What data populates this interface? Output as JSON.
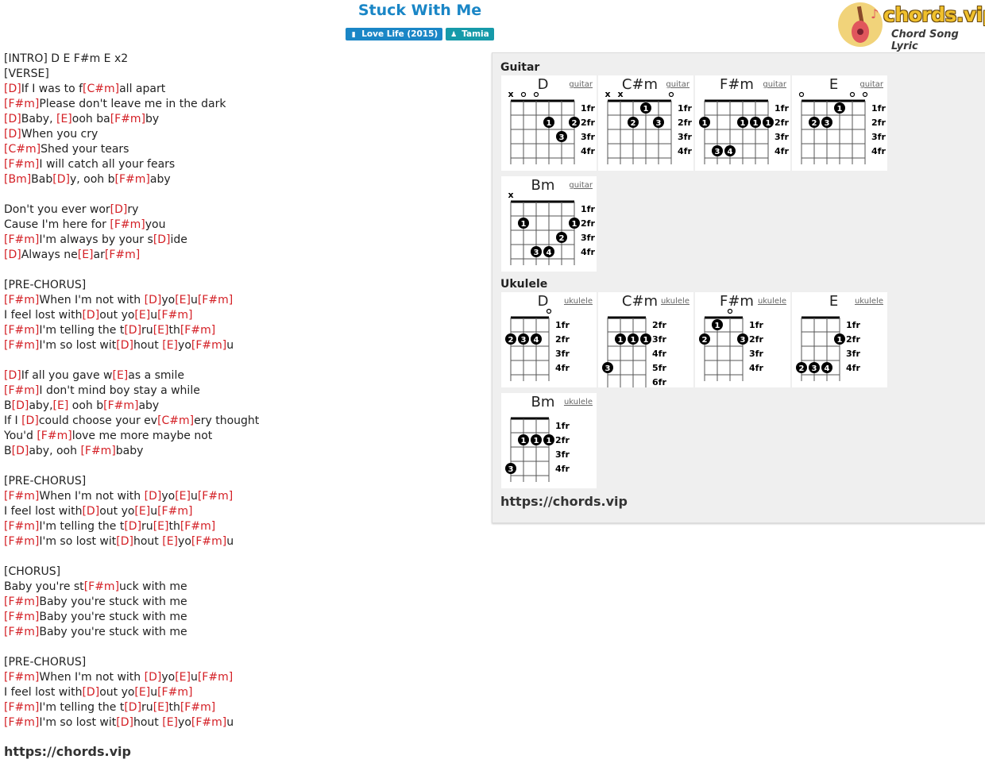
{
  "song": {
    "title": "Stuck With Me",
    "album_tag": "Love Life (2015)",
    "artist_tag": "Tamia"
  },
  "logo": {
    "brand": "chords.vip",
    "tagline": "Chord Song Lyric"
  },
  "lyrics": [
    [
      {
        "t": "[INTRO] D E F#m E x2"
      }
    ],
    [
      {
        "t": "[VERSE]"
      }
    ],
    [
      {
        "c": "[D]"
      },
      {
        "t": "If I was to f"
      },
      {
        "c": "[C#m]"
      },
      {
        "t": "all apart"
      }
    ],
    [
      {
        "c": "[F#m]"
      },
      {
        "t": "Please don't leave me in the dark"
      }
    ],
    [
      {
        "c": "[D]"
      },
      {
        "t": "Baby, "
      },
      {
        "c": "[E]"
      },
      {
        "t": "ooh ba"
      },
      {
        "c": "[F#m]"
      },
      {
        "t": "by"
      }
    ],
    [
      {
        "c": "[D]"
      },
      {
        "t": "When you cry"
      }
    ],
    [
      {
        "c": "[C#m]"
      },
      {
        "t": "Shed your tears"
      }
    ],
    [
      {
        "c": "[F#m]"
      },
      {
        "t": "I will catch all your fears"
      }
    ],
    [
      {
        "c": "[Bm]"
      },
      {
        "t": "Bab"
      },
      {
        "c": "[D]"
      },
      {
        "t": "y, ooh b"
      },
      {
        "c": "[F#m]"
      },
      {
        "t": "aby"
      }
    ],
    [],
    [
      {
        "t": "Don't you ever wor"
      },
      {
        "c": "[D]"
      },
      {
        "t": "ry"
      }
    ],
    [
      {
        "t": "Cause I'm here for "
      },
      {
        "c": "[F#m]"
      },
      {
        "t": "you"
      }
    ],
    [
      {
        "c": "[F#m]"
      },
      {
        "t": "I'm always by your s"
      },
      {
        "c": "[D]"
      },
      {
        "t": "ide"
      }
    ],
    [
      {
        "c": "[D]"
      },
      {
        "t": "Always ne"
      },
      {
        "c": "[E]"
      },
      {
        "t": "ar"
      },
      {
        "c": "[F#m]"
      }
    ],
    [],
    [
      {
        "t": "[PRE-CHORUS]"
      }
    ],
    [
      {
        "c": "[F#m]"
      },
      {
        "t": "When I'm not with "
      },
      {
        "c": "[D]"
      },
      {
        "t": "yo"
      },
      {
        "c": "[E]"
      },
      {
        "t": "u"
      },
      {
        "c": "[F#m]"
      }
    ],
    [
      {
        "t": "I feel lost with"
      },
      {
        "c": "[D]"
      },
      {
        "t": "out yo"
      },
      {
        "c": "[E]"
      },
      {
        "t": "u"
      },
      {
        "c": "[F#m]"
      }
    ],
    [
      {
        "c": "[F#m]"
      },
      {
        "t": "I'm telling the t"
      },
      {
        "c": "[D]"
      },
      {
        "t": "ru"
      },
      {
        "c": "[E]"
      },
      {
        "t": "th"
      },
      {
        "c": "[F#m]"
      }
    ],
    [
      {
        "c": "[F#m]"
      },
      {
        "t": "I'm so lost wit"
      },
      {
        "c": "[D]"
      },
      {
        "t": "hout "
      },
      {
        "c": "[E]"
      },
      {
        "t": "yo"
      },
      {
        "c": "[F#m]"
      },
      {
        "t": "u"
      }
    ],
    [],
    [
      {
        "c": "[D]"
      },
      {
        "t": "If all you gave w"
      },
      {
        "c": "[E]"
      },
      {
        "t": "as a smile"
      }
    ],
    [
      {
        "c": "[F#m]"
      },
      {
        "t": "I don't mind boy stay a while"
      }
    ],
    [
      {
        "t": "B"
      },
      {
        "c": "[D]"
      },
      {
        "t": "aby,"
      },
      {
        "c": "[E]"
      },
      {
        "t": " ooh b"
      },
      {
        "c": "[F#m]"
      },
      {
        "t": "aby"
      }
    ],
    [
      {
        "t": "If I "
      },
      {
        "c": "[D]"
      },
      {
        "t": "could choose your ev"
      },
      {
        "c": "[C#m]"
      },
      {
        "t": "ery thought"
      }
    ],
    [
      {
        "t": "You'd "
      },
      {
        "c": "[F#m]"
      },
      {
        "t": "love me more maybe not"
      }
    ],
    [
      {
        "t": "B"
      },
      {
        "c": "[D]"
      },
      {
        "t": "aby, ooh "
      },
      {
        "c": "[F#m]"
      },
      {
        "t": "baby"
      }
    ],
    [],
    [
      {
        "t": "[PRE-CHORUS]"
      }
    ],
    [
      {
        "c": "[F#m]"
      },
      {
        "t": "When I'm not with "
      },
      {
        "c": "[D]"
      },
      {
        "t": "yo"
      },
      {
        "c": "[E]"
      },
      {
        "t": "u"
      },
      {
        "c": "[F#m]"
      }
    ],
    [
      {
        "t": "I feel lost with"
      },
      {
        "c": "[D]"
      },
      {
        "t": "out yo"
      },
      {
        "c": "[E]"
      },
      {
        "t": "u"
      },
      {
        "c": "[F#m]"
      }
    ],
    [
      {
        "c": "[F#m]"
      },
      {
        "t": "I'm telling the t"
      },
      {
        "c": "[D]"
      },
      {
        "t": "ru"
      },
      {
        "c": "[E]"
      },
      {
        "t": "th"
      },
      {
        "c": "[F#m]"
      }
    ],
    [
      {
        "c": "[F#m]"
      },
      {
        "t": "I'm so lost wit"
      },
      {
        "c": "[D]"
      },
      {
        "t": "hout "
      },
      {
        "c": "[E]"
      },
      {
        "t": "yo"
      },
      {
        "c": "[F#m]"
      },
      {
        "t": "u"
      }
    ],
    [],
    [
      {
        "t": "[CHORUS]"
      }
    ],
    [
      {
        "t": "Baby you're st"
      },
      {
        "c": "[F#m]"
      },
      {
        "t": "uck with me"
      }
    ],
    [
      {
        "c": "[F#m]"
      },
      {
        "t": "Baby you're stuck with me"
      }
    ],
    [
      {
        "c": "[F#m]"
      },
      {
        "t": "Baby you're stuck with me"
      }
    ],
    [
      {
        "c": "[F#m]"
      },
      {
        "t": "Baby you're stuck with me"
      }
    ],
    [],
    [
      {
        "t": "[PRE-CHORUS]"
      }
    ],
    [
      {
        "c": "[F#m]"
      },
      {
        "t": "When I'm not with "
      },
      {
        "c": "[D]"
      },
      {
        "t": "yo"
      },
      {
        "c": "[E]"
      },
      {
        "t": "u"
      },
      {
        "c": "[F#m]"
      }
    ],
    [
      {
        "t": "I feel lost with"
      },
      {
        "c": "[D]"
      },
      {
        "t": "out yo"
      },
      {
        "c": "[E]"
      },
      {
        "t": "u"
      },
      {
        "c": "[F#m]"
      }
    ],
    [
      {
        "c": "[F#m]"
      },
      {
        "t": "I'm telling the t"
      },
      {
        "c": "[D]"
      },
      {
        "t": "ru"
      },
      {
        "c": "[E]"
      },
      {
        "t": "th"
      },
      {
        "c": "[F#m]"
      }
    ],
    [
      {
        "c": "[F#m]"
      },
      {
        "t": "I'm so lost wit"
      },
      {
        "c": "[D]"
      },
      {
        "t": "hout "
      },
      {
        "c": "[E]"
      },
      {
        "t": "yo"
      },
      {
        "c": "[F#m]"
      },
      {
        "t": "u"
      }
    ]
  ],
  "footer_url": "https://chords.vip",
  "panel": {
    "guitar_label": "Guitar",
    "ukulele_label": "Ukulele",
    "url": "https://chords.vip",
    "guitar_chords": [
      {
        "name": "D",
        "inst": "guitar",
        "frets": [
          "1fr",
          "2fr",
          "3fr",
          "4fr"
        ],
        "marks": [
          {
            "s": 0,
            "m": "x"
          },
          {
            "s": 1,
            "m": "o"
          },
          {
            "s": 2,
            "m": "o"
          }
        ],
        "dots": [
          {
            "s": 3,
            "f": 2,
            "n": "1"
          },
          {
            "s": 5,
            "f": 2,
            "n": "2"
          },
          {
            "s": 4,
            "f": 3,
            "n": "3"
          }
        ]
      },
      {
        "name": "C#m",
        "inst": "guitar",
        "frets": [
          "1fr",
          "2fr",
          "3fr",
          "4fr"
        ],
        "marks": [
          {
            "s": 0,
            "m": "x"
          },
          {
            "s": 1,
            "m": "x"
          },
          {
            "s": 5,
            "m": "o"
          }
        ],
        "dots": [
          {
            "s": 3,
            "f": 1,
            "n": "1"
          },
          {
            "s": 2,
            "f": 2,
            "n": "2"
          },
          {
            "s": 4,
            "f": 2,
            "n": "3"
          }
        ]
      },
      {
        "name": "F#m",
        "inst": "guitar",
        "frets": [
          "1fr",
          "2fr",
          "3fr",
          "4fr"
        ],
        "marks": [],
        "dots": [
          {
            "s": 0,
            "f": 2,
            "n": "1"
          },
          {
            "s": 3,
            "f": 2,
            "n": "1"
          },
          {
            "s": 4,
            "f": 2,
            "n": "1"
          },
          {
            "s": 5,
            "f": 2,
            "n": "1"
          },
          {
            "s": 1,
            "f": 4,
            "n": "3"
          },
          {
            "s": 2,
            "f": 4,
            "n": "4"
          }
        ]
      },
      {
        "name": "E",
        "inst": "guitar",
        "frets": [
          "1fr",
          "2fr",
          "3fr",
          "4fr"
        ],
        "marks": [
          {
            "s": 0,
            "m": "o"
          },
          {
            "s": 4,
            "m": "o"
          },
          {
            "s": 5,
            "m": "o"
          }
        ],
        "dots": [
          {
            "s": 3,
            "f": 1,
            "n": "1"
          },
          {
            "s": 1,
            "f": 2,
            "n": "2"
          },
          {
            "s": 2,
            "f": 2,
            "n": "3"
          }
        ]
      },
      {
        "name": "Bm",
        "inst": "guitar",
        "frets": [
          "1fr",
          "2fr",
          "3fr",
          "4fr"
        ],
        "marks": [
          {
            "s": 0,
            "m": "x"
          }
        ],
        "dots": [
          {
            "s": 1,
            "f": 2,
            "n": "1"
          },
          {
            "s": 5,
            "f": 2,
            "n": "1"
          },
          {
            "s": 4,
            "f": 3,
            "n": "2"
          },
          {
            "s": 2,
            "f": 4,
            "n": "3"
          },
          {
            "s": 3,
            "f": 4,
            "n": "4"
          }
        ]
      }
    ],
    "ukulele_chords": [
      {
        "name": "D",
        "inst": "ukulele",
        "frets": [
          "1fr",
          "2fr",
          "3fr",
          "4fr"
        ],
        "marks": [
          {
            "s": 3,
            "m": "o"
          }
        ],
        "dots": [
          {
            "s": 0,
            "f": 2,
            "n": "2"
          },
          {
            "s": 1,
            "f": 2,
            "n": "3"
          },
          {
            "s": 2,
            "f": 2,
            "n": "4"
          }
        ]
      },
      {
        "name": "C#m",
        "inst": "ukulele",
        "frets": [
          "2fr",
          "3fr",
          "4fr",
          "5fr",
          "6fr"
        ],
        "marks": [],
        "dots": [
          {
            "s": 1,
            "f": 2,
            "n": "1"
          },
          {
            "s": 2,
            "f": 2,
            "n": "1"
          },
          {
            "s": 3,
            "f": 2,
            "n": "1"
          },
          {
            "s": 0,
            "f": 4,
            "n": "3"
          }
        ]
      },
      {
        "name": "F#m",
        "inst": "ukulele",
        "frets": [
          "1fr",
          "2fr",
          "3fr",
          "4fr"
        ],
        "marks": [
          {
            "s": 2,
            "m": "o"
          }
        ],
        "dots": [
          {
            "s": 1,
            "f": 1,
            "n": "1"
          },
          {
            "s": 0,
            "f": 2,
            "n": "2"
          },
          {
            "s": 3,
            "f": 2,
            "n": "3"
          }
        ]
      },
      {
        "name": "E",
        "inst": "ukulele",
        "frets": [
          "1fr",
          "2fr",
          "3fr",
          "4fr"
        ],
        "marks": [],
        "dots": [
          {
            "s": 3,
            "f": 2,
            "n": "1"
          },
          {
            "s": 0,
            "f": 4,
            "n": "2"
          },
          {
            "s": 1,
            "f": 4,
            "n": "3"
          },
          {
            "s": 2,
            "f": 4,
            "n": "4"
          }
        ]
      },
      {
        "name": "Bm",
        "inst": "ukulele",
        "frets": [
          "1fr",
          "2fr",
          "3fr",
          "4fr"
        ],
        "marks": [],
        "dots": [
          {
            "s": 1,
            "f": 2,
            "n": "1"
          },
          {
            "s": 2,
            "f": 2,
            "n": "1"
          },
          {
            "s": 3,
            "f": 2,
            "n": "1"
          },
          {
            "s": 0,
            "f": 4,
            "n": "3"
          }
        ]
      }
    ]
  }
}
